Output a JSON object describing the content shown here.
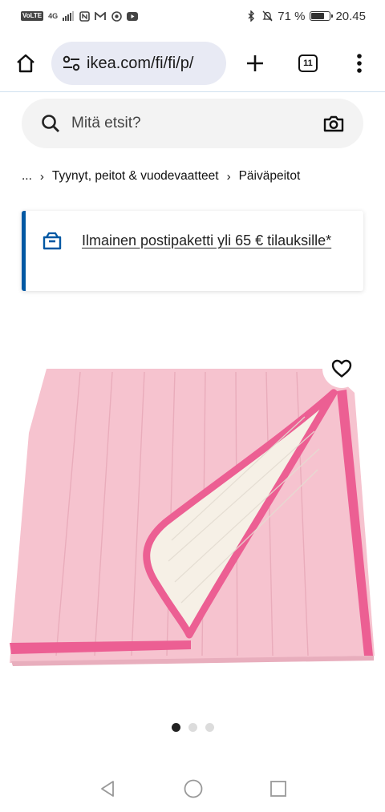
{
  "status_bar": {
    "chip": "VoLTE",
    "network": "4G",
    "battery_percent": "71 %",
    "battery_level": 0.71,
    "time": "20.45"
  },
  "browser": {
    "url": "ikea.com/fi/fi/p/",
    "tab_count": "11"
  },
  "search": {
    "placeholder": "Mitä etsit?"
  },
  "breadcrumb": {
    "ellipsis": "...",
    "items": [
      "Tyynyt, peitot & vuodevaatteet",
      "Päiväpeitot"
    ]
  },
  "promo": {
    "text": "Ilmainen postipaketti yli 65 € tilauksille*"
  },
  "carousel": {
    "total": 3,
    "active": 1
  },
  "colors": {
    "accent_blue": "#0058a3",
    "blanket_pink": "#f6c3cf",
    "trim_pink": "#ec5f93",
    "lining_cream": "#f6f0e6"
  }
}
